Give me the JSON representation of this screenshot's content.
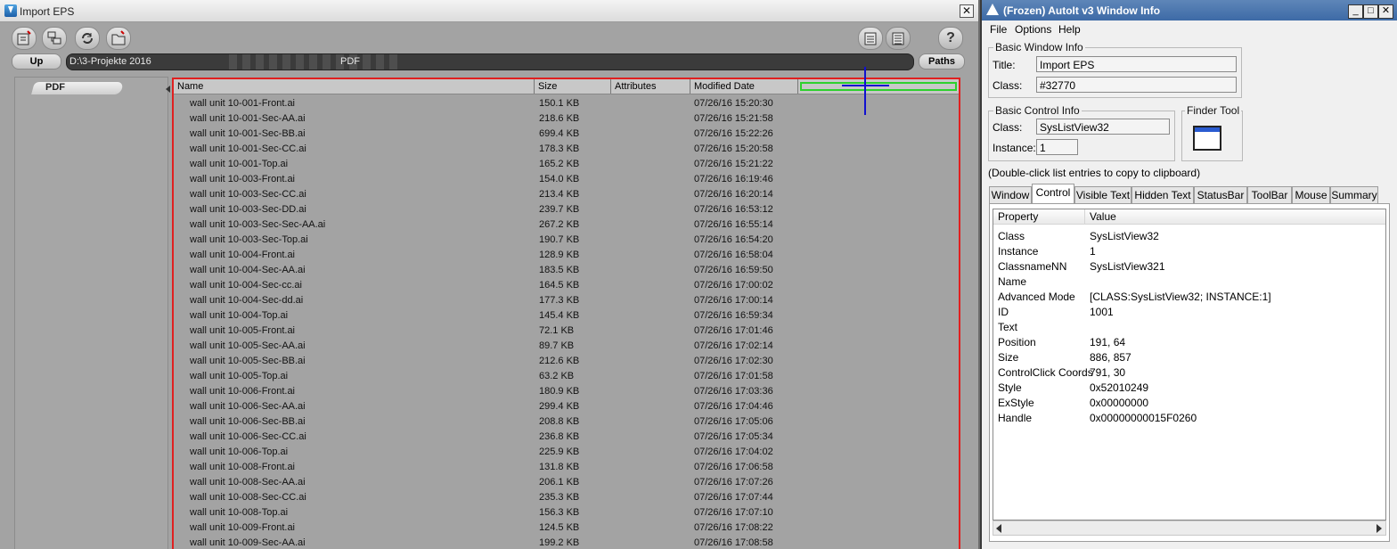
{
  "import_eps": {
    "title": "Import EPS",
    "close_glyph": "✕",
    "toolbar": {
      "icons": [
        "new-folder-icon",
        "network-drive-icon",
        "refresh-icon",
        "open-folder-icon"
      ],
      "view_icons": [
        "thumbnail-view-icon",
        "list-view-icon"
      ],
      "help_label": "?"
    },
    "up_label": "Up",
    "path_prefix": "D:\\3-Projekte 2016",
    "path_suffix": "PDF",
    "paths_label": "Paths",
    "folder_tab": "PDF",
    "columns": [
      "Name",
      "Size",
      "Attributes",
      "Modified Date"
    ],
    "files": [
      {
        "name": "wall unit 10-001-Front.ai",
        "size": "150.1 KB",
        "date": "07/26/16 15:20:30"
      },
      {
        "name": "wall unit 10-001-Sec-AA.ai",
        "size": "218.6 KB",
        "date": "07/26/16 15:21:58"
      },
      {
        "name": "wall unit 10-001-Sec-BB.ai",
        "size": "699.4 KB",
        "date": "07/26/16 15:22:26"
      },
      {
        "name": "wall unit 10-001-Sec-CC.ai",
        "size": "178.3 KB",
        "date": "07/26/16 15:20:58"
      },
      {
        "name": "wall unit 10-001-Top.ai",
        "size": "165.2 KB",
        "date": "07/26/16 15:21:22"
      },
      {
        "name": "wall unit 10-003-Front.ai",
        "size": "154.0 KB",
        "date": "07/26/16 16:19:46"
      },
      {
        "name": "wall unit 10-003-Sec-CC.ai",
        "size": "213.4 KB",
        "date": "07/26/16 16:20:14"
      },
      {
        "name": "wall unit 10-003-Sec-DD.ai",
        "size": "239.7 KB",
        "date": "07/26/16 16:53:12"
      },
      {
        "name": "wall unit 10-003-Sec-Sec-AA.ai",
        "size": "267.2 KB",
        "date": "07/26/16 16:55:14"
      },
      {
        "name": "wall unit 10-003-Sec-Top.ai",
        "size": "190.7 KB",
        "date": "07/26/16 16:54:20"
      },
      {
        "name": "wall unit 10-004-Front.ai",
        "size": "128.9 KB",
        "date": "07/26/16 16:58:04"
      },
      {
        "name": "wall unit 10-004-Sec-AA.ai",
        "size": "183.5 KB",
        "date": "07/26/16 16:59:50"
      },
      {
        "name": "wall unit 10-004-Sec-cc.ai",
        "size": "164.5 KB",
        "date": "07/26/16 17:00:02"
      },
      {
        "name": "wall unit 10-004-Sec-dd.ai",
        "size": "177.3 KB",
        "date": "07/26/16 17:00:14"
      },
      {
        "name": "wall unit 10-004-Top.ai",
        "size": "145.4 KB",
        "date": "07/26/16 16:59:34"
      },
      {
        "name": "wall unit 10-005-Front.ai",
        "size": "72.1 KB",
        "date": "07/26/16 17:01:46"
      },
      {
        "name": "wall unit 10-005-Sec-AA.ai",
        "size": "89.7 KB",
        "date": "07/26/16 17:02:14"
      },
      {
        "name": "wall unit 10-005-Sec-BB.ai",
        "size": "212.6 KB",
        "date": "07/26/16 17:02:30"
      },
      {
        "name": "wall unit 10-005-Top.ai",
        "size": "63.2 KB",
        "date": "07/26/16 17:01:58"
      },
      {
        "name": "wall unit 10-006-Front.ai",
        "size": "180.9 KB",
        "date": "07/26/16 17:03:36"
      },
      {
        "name": "wall unit 10-006-Sec-AA.ai",
        "size": "299.4 KB",
        "date": "07/26/16 17:04:46"
      },
      {
        "name": "wall unit 10-006-Sec-BB.ai",
        "size": "208.8 KB",
        "date": "07/26/16 17:05:06"
      },
      {
        "name": "wall unit 10-006-Sec-CC.ai",
        "size": "236.8 KB",
        "date": "07/26/16 17:05:34"
      },
      {
        "name": "wall unit 10-006-Top.ai",
        "size": "225.9 KB",
        "date": "07/26/16 17:04:02"
      },
      {
        "name": "wall unit 10-008-Front.ai",
        "size": "131.8 KB",
        "date": "07/26/16 17:06:58"
      },
      {
        "name": "wall unit 10-008-Sec-AA.ai",
        "size": "206.1 KB",
        "date": "07/26/16 17:07:26"
      },
      {
        "name": "wall unit 10-008-Sec-CC.ai",
        "size": "235.3 KB",
        "date": "07/26/16 17:07:44"
      },
      {
        "name": "wall unit 10-008-Top.ai",
        "size": "156.3 KB",
        "date": "07/26/16 17:07:10"
      },
      {
        "name": "wall unit 10-009-Front.ai",
        "size": "124.5 KB",
        "date": "07/26/16 17:08:22"
      },
      {
        "name": "wall unit 10-009-Sec-AA.ai",
        "size": "199.2 KB",
        "date": "07/26/16 17:08:58"
      }
    ],
    "colors": {
      "highlight_border": "#e02020",
      "hover_box": "#2ed12e",
      "crosshair": "#1010d0"
    }
  },
  "autoit": {
    "title": "(Frozen) AutoIt v3 Window Info",
    "window_buttons": [
      "_",
      "□",
      "✕"
    ],
    "menu": [
      "File",
      "Options",
      "Help"
    ],
    "basic_window_info": {
      "legend": "Basic Window Info",
      "title_label": "Title:",
      "title_value": "Import EPS",
      "class_label": "Class:",
      "class_value": "#32770"
    },
    "basic_control_info": {
      "legend": "Basic Control Info",
      "class_label": "Class:",
      "class_value": "SysListView32",
      "instance_label": "Instance:",
      "instance_value": "1"
    },
    "finder_tool_legend": "Finder Tool",
    "hint": "(Double-click list entries to copy to clipboard)",
    "tabs": [
      "Window",
      "Control",
      "Visible Text",
      "Hidden Text",
      "StatusBar",
      "ToolBar",
      "Mouse",
      "Summary"
    ],
    "selected_tab": "Control",
    "prop_headers": [
      "Property",
      "Value"
    ],
    "properties": [
      {
        "property": "Class",
        "value": "SysListView32"
      },
      {
        "property": "Instance",
        "value": "1"
      },
      {
        "property": "ClassnameNN",
        "value": "SysListView321"
      },
      {
        "property": "Name",
        "value": ""
      },
      {
        "property": "Advanced Mode",
        "value": "[CLASS:SysListView32; INSTANCE:1]"
      },
      {
        "property": "ID",
        "value": "1001"
      },
      {
        "property": "Text",
        "value": ""
      },
      {
        "property": "Position",
        "value": "191, 64"
      },
      {
        "property": "Size",
        "value": "886, 857"
      },
      {
        "property": "ControlClick Coords",
        "value": "791, 30"
      },
      {
        "property": "Style",
        "value": "0x52010249"
      },
      {
        "property": "ExStyle",
        "value": "0x00000000"
      },
      {
        "property": "Handle",
        "value": "0x00000000015F0260"
      }
    ]
  }
}
